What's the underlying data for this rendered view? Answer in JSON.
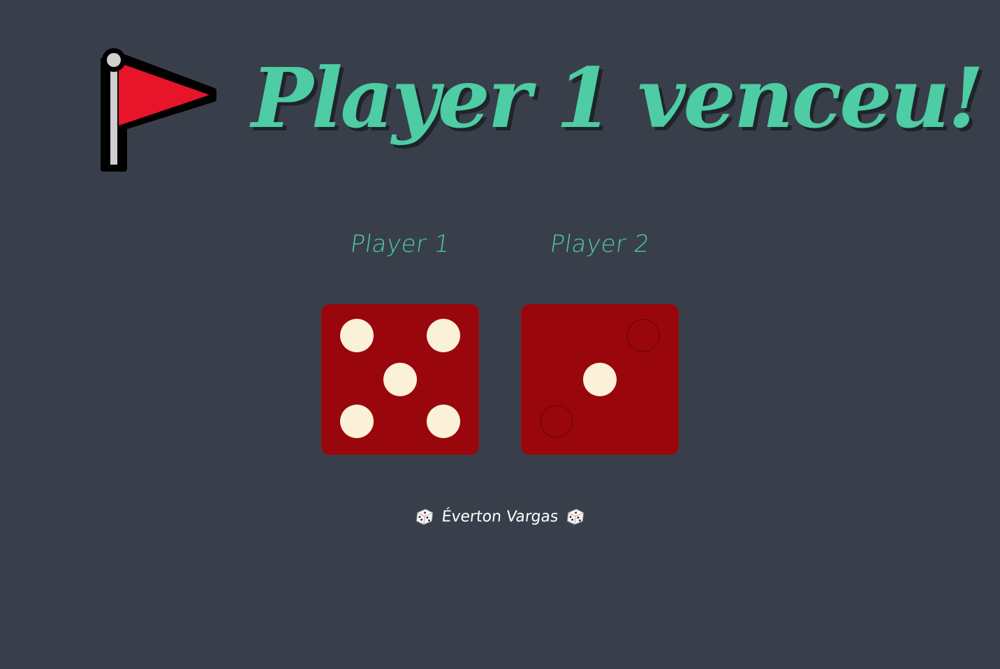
{
  "result": {
    "headline": "Player 1 venceu!",
    "icon": "red-flag-icon"
  },
  "players": [
    {
      "name": "Player 1",
      "die_value": 5
    },
    {
      "name": "Player 2",
      "die_value": 1
    }
  ],
  "footer": {
    "credit": "Éverton Vargas",
    "icon": "die-icon"
  },
  "colors": {
    "background": "#393f4a",
    "accent": "#4ecca3",
    "die_face": "#99070d",
    "pip": "#fbf1d8",
    "flag": "#e8142a"
  }
}
